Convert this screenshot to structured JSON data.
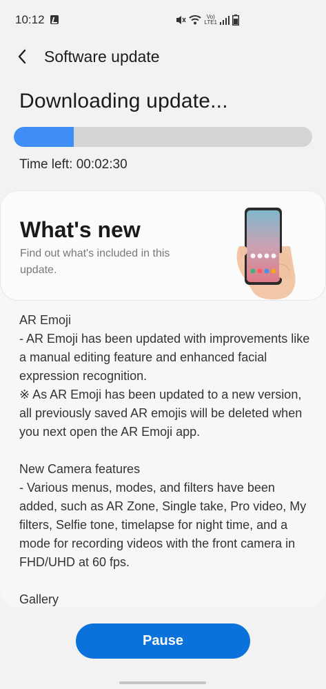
{
  "status_bar": {
    "time": "10:12",
    "network_label_top": "Vo)",
    "network_label_bottom": "LTE1",
    "icons": [
      "app-notification-icon",
      "mute-icon",
      "wifi-icon",
      "signal-icon",
      "battery-icon"
    ]
  },
  "app_bar": {
    "back_icon": "back-arrow-icon",
    "title": "Software update"
  },
  "download": {
    "status_text": "Downloading update...",
    "progress": 0.2,
    "time_left": "Time left: 00:02:30",
    "progress_color": "#3e8ef5"
  },
  "whats_new": {
    "title": "What's new",
    "subtitle": "Find out what's included in this update."
  },
  "release_notes": "AR Emoji\n- AR Emoji has been updated with improvements like a manual editing feature and enhanced facial expression recognition.\n※ As AR Emoji has been updated to a new version, all previously saved AR emojis will be deleted when you next open the AR Emoji app.\n\nNew Camera features\n- Various menus, modes, and filters have been added, such as AR Zone, Single take, Pro video, My filters, Selfie tone, timelapse for night time, and a mode for recording videos with the front camera in FHD/UHD at 60 fps.\n\nGallery",
  "actions": {
    "pause_label": "Pause",
    "accent_color": "#0b72db"
  }
}
